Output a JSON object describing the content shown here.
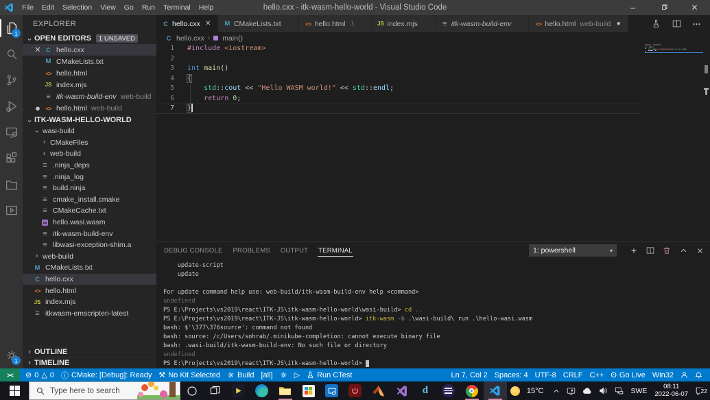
{
  "titlebar": {
    "title": "hello.cxx - itk-wasm-hello-world - Visual Studio Code",
    "menus": [
      "File",
      "Edit",
      "Selection",
      "View",
      "Go",
      "Run",
      "Terminal",
      "Help"
    ]
  },
  "activity_bar": {
    "items": [
      {
        "name": "explorer",
        "badge": "1",
        "active": true
      },
      {
        "name": "search"
      },
      {
        "name": "source-control"
      },
      {
        "name": "run-debug"
      },
      {
        "name": "remote-explorer"
      },
      {
        "name": "extensions"
      },
      {
        "name": "project-manager"
      },
      {
        "name": "live-preview"
      }
    ],
    "bottom": [
      {
        "name": "settings",
        "badge": "1"
      }
    ]
  },
  "sidebar": {
    "title": "EXPLORER",
    "open_editors": {
      "label": "OPEN EDITORS",
      "badge": "1 UNSAVED",
      "items": [
        {
          "icon": "cpp",
          "name": "hello.cxx",
          "selected": true,
          "closable": true
        },
        {
          "icon": "cmake",
          "name": "CMakeLists.txt"
        },
        {
          "icon": "html",
          "name": "hello.html"
        },
        {
          "icon": "js",
          "name": "index.mjs"
        },
        {
          "icon": "file",
          "name": "itk-wasm-build-env",
          "suffix": "web-build",
          "preview": true
        },
        {
          "icon": "html",
          "name": "hello.html",
          "suffix": "web-build",
          "modified": true
        }
      ]
    },
    "workspace": {
      "label": "ITK-WASM-HELLO-WORLD",
      "items": [
        {
          "kind": "folder",
          "expanded": true,
          "name": "wasi-build",
          "level": 0
        },
        {
          "kind": "folder",
          "name": "CMakeFiles",
          "level": 1
        },
        {
          "kind": "folder",
          "name": "web-build",
          "level": 1
        },
        {
          "kind": "file",
          "icon": "file",
          "name": ".ninja_deps",
          "level": 1
        },
        {
          "kind": "file",
          "icon": "file",
          "name": ".ninja_log",
          "level": 1
        },
        {
          "kind": "file",
          "icon": "file",
          "name": "build.ninja",
          "level": 1
        },
        {
          "kind": "file",
          "icon": "file",
          "name": "cmake_install.cmake",
          "level": 1
        },
        {
          "kind": "file",
          "icon": "file",
          "name": "CMakeCache.txt",
          "level": 1
        },
        {
          "kind": "file",
          "icon": "wasm",
          "name": "hello.wasi.wasm",
          "level": 1
        },
        {
          "kind": "file",
          "icon": "file",
          "name": "itk-wasm-build-env",
          "level": 1
        },
        {
          "kind": "file",
          "icon": "file",
          "name": "libwasi-exception-shim.a",
          "level": 1
        },
        {
          "kind": "folder",
          "name": "web-build",
          "level": 0
        },
        {
          "kind": "file",
          "icon": "cmake",
          "name": "CMakeLists.txt",
          "level": 0
        },
        {
          "kind": "file",
          "icon": "cpp",
          "name": "hello.cxx",
          "level": 0,
          "selected": true
        },
        {
          "kind": "file",
          "icon": "html",
          "name": "hello.html",
          "level": 0
        },
        {
          "kind": "file",
          "icon": "js",
          "name": "index.mjs",
          "level": 0
        },
        {
          "kind": "file",
          "icon": "file",
          "name": "itkwasm-emscripten-latest",
          "level": 0
        }
      ]
    },
    "outline_label": "OUTLINE",
    "timeline_label": "TIMELINE"
  },
  "editor": {
    "tabs": [
      {
        "icon": "cpp",
        "name": "hello.cxx",
        "active": true,
        "closable": true
      },
      {
        "icon": "cmake",
        "name": "CMakeLists.txt"
      },
      {
        "icon": "html",
        "name": "hello.html",
        "suffix": ".\\"
      },
      {
        "icon": "js",
        "name": "index.mjs"
      },
      {
        "icon": "file",
        "name": "itk-wasm-build-env",
        "preview": true
      },
      {
        "icon": "html",
        "name": "hello.html",
        "suffix": "web-build",
        "modified": true
      }
    ],
    "breadcrumb": [
      {
        "icon": "cpp",
        "label": "hello.cxx"
      },
      {
        "icon": "symbol",
        "label": "main()"
      }
    ],
    "code_lines": [
      [
        {
          "t": "#include",
          "c": "k2"
        },
        {
          "t": " "
        },
        {
          "t": "<iostream>",
          "c": "str"
        }
      ],
      [],
      [
        {
          "t": "int",
          "c": "kw"
        },
        {
          "t": " "
        },
        {
          "t": "main",
          "c": "fn"
        },
        {
          "t": "()"
        }
      ],
      [
        {
          "t": "{",
          "c": "bracket"
        }
      ],
      [
        {
          "t": "    "
        },
        {
          "t": "std",
          "c": "ns"
        },
        {
          "t": "::"
        },
        {
          "t": "cout",
          "c": "var"
        },
        {
          "t": " << "
        },
        {
          "t": "\"Hello WASM world!\"",
          "c": "str"
        },
        {
          "t": " << "
        },
        {
          "t": "std",
          "c": "ns"
        },
        {
          "t": "::"
        },
        {
          "t": "endl",
          "c": "var"
        },
        {
          "t": ";"
        }
      ],
      [
        {
          "t": "    "
        },
        {
          "t": "return",
          "c": "k2"
        },
        {
          "t": " "
        },
        {
          "t": "0",
          "c": "num"
        },
        {
          "t": ";"
        }
      ],
      [
        {
          "t": "}",
          "c": "bracket"
        },
        {
          "t": "",
          "c": "cursor"
        }
      ]
    ]
  },
  "panel": {
    "tabs": [
      {
        "label": "DEBUG CONSOLE"
      },
      {
        "label": "PROBLEMS"
      },
      {
        "label": "OUTPUT"
      },
      {
        "label": "TERMINAL",
        "active": true
      }
    ],
    "shell_selector": "1: powershell",
    "terminal_lines": [
      [
        {
          "t": "    update-script"
        }
      ],
      [
        {
          "t": "    update"
        }
      ],
      [],
      [
        {
          "t": "For update command help use: web-build/itk-wasm-build-env help <command>"
        }
      ],
      [
        {
          "t": "undefined",
          "c": "dim"
        }
      ],
      [
        {
          "t": "PS E:\\Projects\\vs2019\\react\\ITK-JS\\itk-wasm-hello-world\\wasi-build> "
        },
        {
          "t": "cd",
          "c": "cmd"
        },
        {
          "t": " "
        },
        {
          "t": "..",
          "c": "arg"
        }
      ],
      [
        {
          "t": "PS E:\\Projects\\vs2019\\react\\ITK-JS\\itk-wasm-hello-world> "
        },
        {
          "t": "itk-wasm",
          "c": "cmd"
        },
        {
          "t": " "
        },
        {
          "t": "-b",
          "c": "arg"
        },
        {
          "t": " .\\wasi-build\\ run .\\hello-wasi.wasm"
        }
      ],
      [
        {
          "t": "bash: $'\\377\\376source': command not found"
        }
      ],
      [
        {
          "t": "bash: source: /c/Users/sohrab/.minikube-completion: cannot execute binary file"
        }
      ],
      [
        {
          "t": "bash: .wasi-build/itk-wasm-build-env: No such file or directory"
        }
      ],
      [
        {
          "t": "undefined",
          "c": "dim"
        }
      ],
      [
        {
          "t": "PS E:\\Projects\\vs2019\\react\\ITK-JS\\itk-wasm-hello-world> "
        },
        {
          "t": " ",
          "c": "cursorblock"
        }
      ]
    ]
  },
  "status_bar": {
    "remote_label": "><",
    "left": [
      {
        "icon": "error",
        "text": "0",
        "icon2": "warning",
        "text2": "0",
        "name": "problems"
      },
      {
        "icon": "info",
        "text": "CMake: [Debug]: Ready",
        "name": "cmake-status"
      },
      {
        "icon": "tools",
        "text": "No Kit Selected",
        "name": "kit-select"
      },
      {
        "icon": "gear",
        "text": "Build",
        "name": "build"
      },
      {
        "text": "[all]",
        "name": "build-target"
      },
      {
        "icon": "bug",
        "text": "",
        "name": "debug-target"
      },
      {
        "icon": "play",
        "text": "",
        "name": "launch"
      },
      {
        "icon": "flask",
        "text": "Run CTest",
        "name": "run-ctest"
      }
    ],
    "right": [
      {
        "text": "Ln 7, Col 2",
        "name": "cursor-position"
      },
      {
        "text": "Spaces: 4",
        "name": "indentation"
      },
      {
        "text": "UTF-8",
        "name": "encoding"
      },
      {
        "text": "CRLF",
        "name": "eol"
      },
      {
        "text": "C++",
        "name": "language-mode"
      },
      {
        "icon": "broadcast",
        "text": "Go Live",
        "name": "go-live"
      },
      {
        "text": "Win32",
        "name": "platform"
      },
      {
        "icon": "person",
        "text": "",
        "name": "feedback"
      },
      {
        "icon": "bell",
        "text": "",
        "name": "notifications"
      }
    ]
  },
  "taskbar": {
    "search_placeholder": "Type here to search",
    "apps": [
      {
        "name": "cortana"
      },
      {
        "name": "task-view"
      },
      {
        "name": "movies-tv"
      },
      {
        "name": "edge"
      },
      {
        "name": "file-explorer",
        "open": true
      },
      {
        "name": "store"
      },
      {
        "name": "dev-app"
      },
      {
        "name": "power-app"
      },
      {
        "name": "matlab"
      },
      {
        "name": "visual-studio"
      },
      {
        "name": "d-app"
      },
      {
        "name": "eclipse"
      },
      {
        "name": "chrome",
        "open": true
      },
      {
        "name": "vscode",
        "open": true,
        "active": true
      }
    ],
    "tray": {
      "temp": "15°C",
      "lang": "SWE",
      "time": "08:11",
      "date": "2022-06-07",
      "badge": "22"
    }
  }
}
